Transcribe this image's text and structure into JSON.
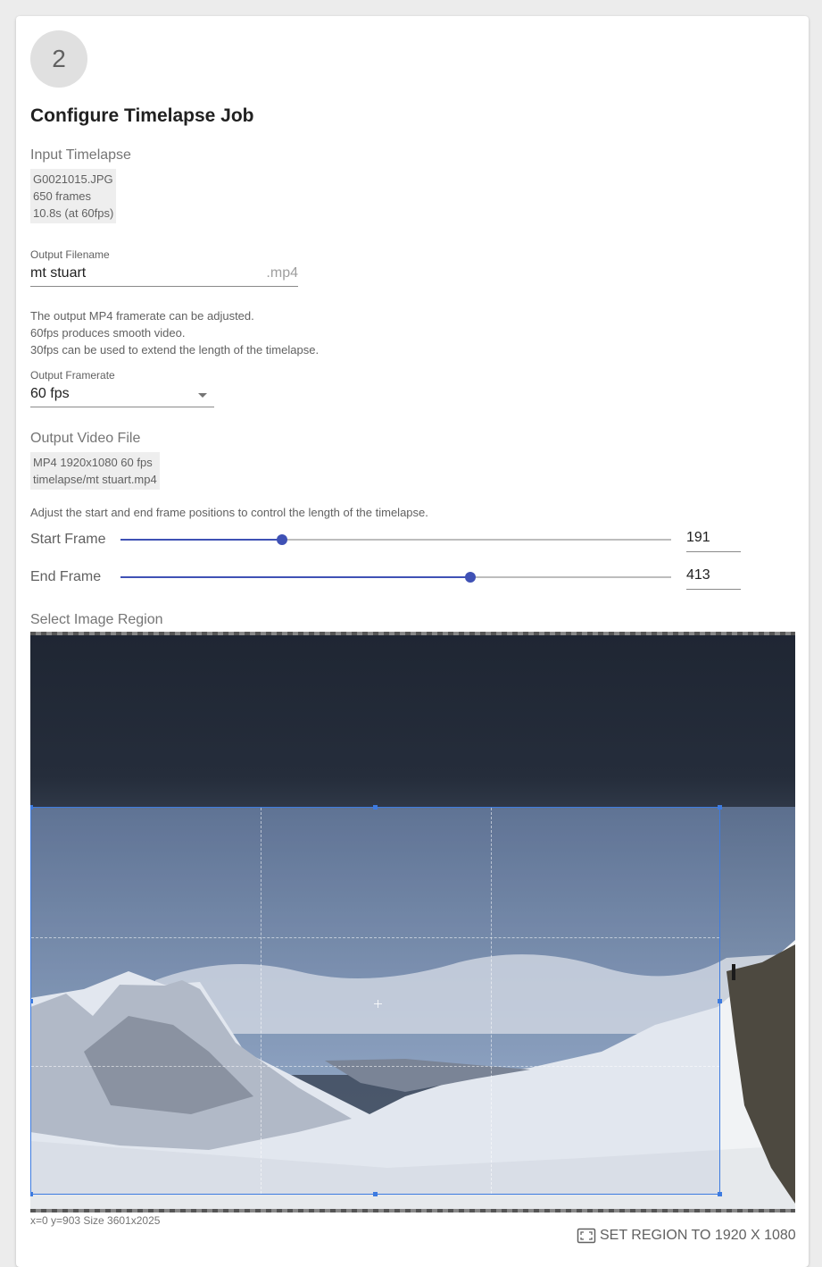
{
  "step": {
    "number": "2"
  },
  "title": "Configure Timelapse Job",
  "input_timelapse": {
    "label": "Input Timelapse",
    "filename": "G0021015.JPG",
    "frames": "650 frames",
    "duration": "10.8s (at 60fps)"
  },
  "output_filename": {
    "label": "Output Filename",
    "value": "mt stuart",
    "suffix": ".mp4"
  },
  "framerate_help": [
    "The output MP4 framerate can be adjusted.",
    "60fps produces smooth video.",
    "30fps can be used to extend the length of the timelapse."
  ],
  "output_framerate": {
    "label": "Output Framerate",
    "value": "60 fps"
  },
  "output_video": {
    "label": "Output Video File",
    "spec": "MP4 1920x1080 60 fps",
    "path": "timelapse/mt stuart.mp4"
  },
  "frame_help": "Adjust the start and end frame positions to control the length of the timelapse.",
  "start_frame": {
    "label": "Start Frame",
    "value": "191",
    "fraction": 0.294
  },
  "end_frame": {
    "label": "End Frame",
    "value": "413",
    "fraction": 0.635
  },
  "image_region": {
    "label": "Select Image Region",
    "coords": "x=0 y=903 Size 3601x2025"
  },
  "region_button": {
    "label": "SET REGION TO 1920 X 1080",
    "icon": "crop-region-icon"
  },
  "colors": {
    "accent": "#3f51b5",
    "crop": "#3d7be0"
  }
}
